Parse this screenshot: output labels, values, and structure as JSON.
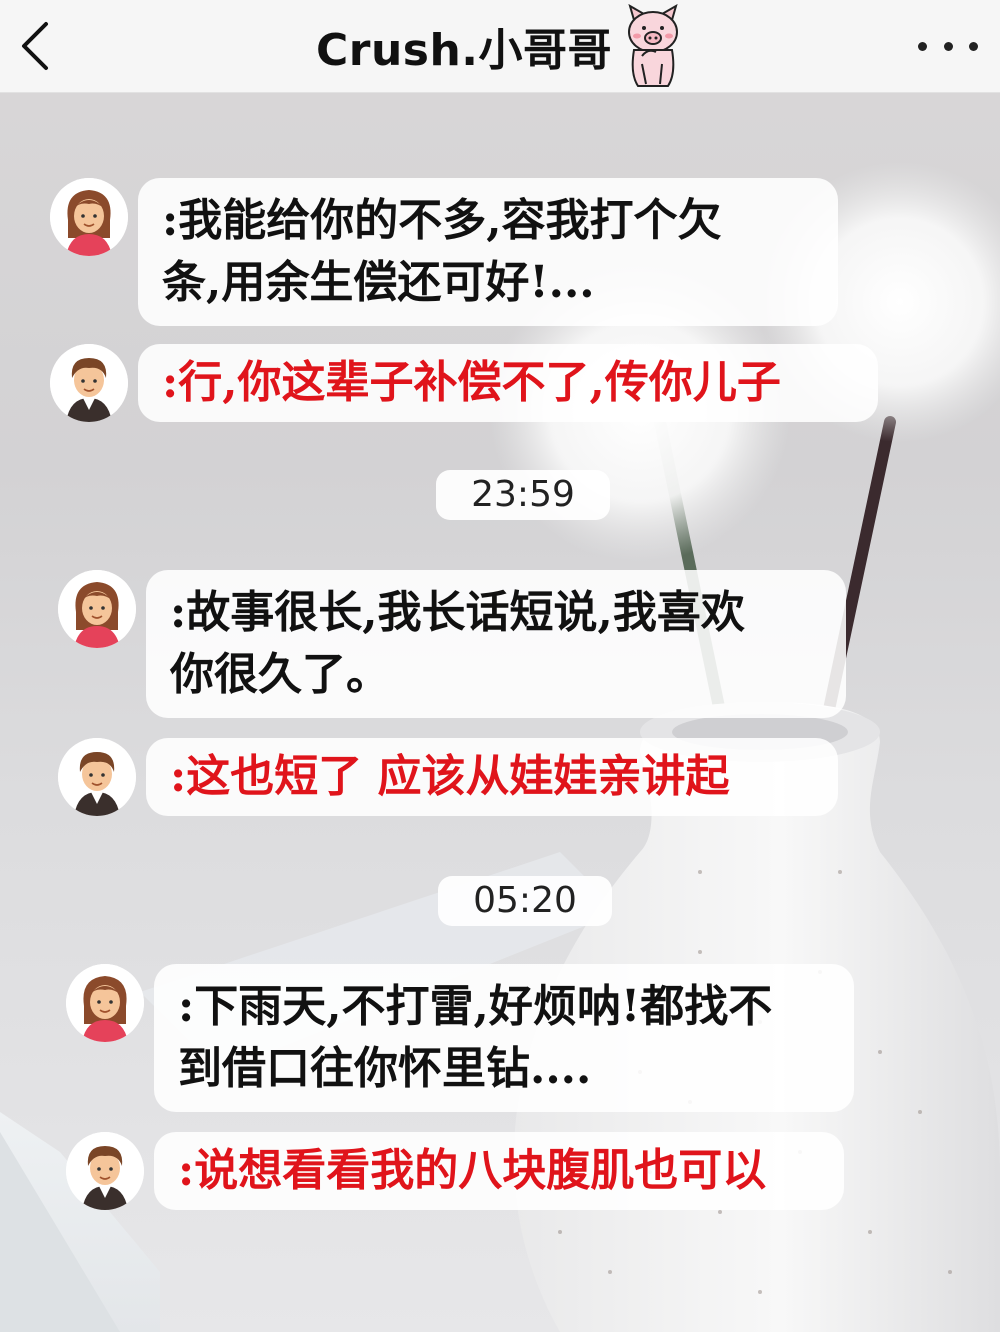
{
  "header": {
    "title": "Crush.小哥哥",
    "back_icon": "chevron-left-icon",
    "more_icon": "ellipsis-icon",
    "title_sticker": "pig-sticker-icon"
  },
  "colors": {
    "red_text": "#e0141b",
    "black_text": "#111111",
    "nav_bg": "#f6f6f6"
  },
  "chat": {
    "messages": [
      {
        "sender": "girl",
        "avatar": "girl-avatar-icon",
        "style": "black",
        "lines": [
          ":我能给你的不多,容我打个欠",
          "条,用余生偿还可好!..."
        ]
      },
      {
        "sender": "boy",
        "avatar": "boy-avatar-icon",
        "style": "red",
        "lines": [
          ":行,你这辈子补偿不了,传你儿子"
        ]
      },
      {
        "sender": "girl",
        "avatar": "girl-avatar-icon",
        "style": "black",
        "lines": [
          ":故事很长,我长话短说,我喜欢",
          "你很久了。"
        ]
      },
      {
        "sender": "boy",
        "avatar": "boy-avatar-icon",
        "style": "red",
        "lines": [
          ":这也短了 应该从娃娃亲讲起"
        ]
      },
      {
        "sender": "girl",
        "avatar": "girl-avatar-icon",
        "style": "black",
        "lines": [
          ":下雨天,不打雷,好烦呐!都找不",
          "到借口往你怀里钻...."
        ]
      },
      {
        "sender": "boy",
        "avatar": "boy-avatar-icon",
        "style": "red",
        "lines": [
          ":说想看看我的八块腹肌也可以"
        ]
      }
    ],
    "timestamps": [
      "23:59",
      "05:20"
    ]
  }
}
